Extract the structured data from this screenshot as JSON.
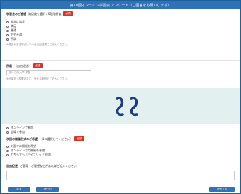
{
  "window": {
    "title": "第10回オンライン学習会 アンケート（ご回答をお願いします）"
  },
  "q1": {
    "label": "学習会のご感想",
    "note": "満足度を選択 / 5段階評価",
    "required_badge": "必須",
    "options": [
      "非常に満足",
      "満足",
      "普通",
      "やや不満",
      "不満"
    ],
    "hint": "※理由がある場合は下の自由記述欄にご記入ください。"
  },
  "q2": {
    "label": "所属",
    "note": "（自由記述）",
    "required_badge": "必須",
    "input_placeholder": "例：〇〇大学 学部",
    "hint": "※団体名・部署名など、分かる範囲でご記入ください。"
  },
  "q3": {
    "options": [
      "オンラインで参加",
      "会場で参加"
    ]
  },
  "q4": {
    "label": "次回の開催形式のご希望",
    "note": "（1つ選択してください）",
    "required_badge": "必須",
    "options": [
      "対面での開催を希望",
      "オンラインでの開催を希望",
      "どちらでも（ハイブリッド形式）"
    ]
  },
  "q5": {
    "label": "自由記述",
    "note": "ご意見・ご要望などがあればご記入ください",
    "input_placeholder": ""
  },
  "buttons": {
    "back": "戻る",
    "reset": "リセット",
    "submit": "送信する"
  },
  "cut_symbol": "≈",
  "colors": {
    "accent": "#2f73b6",
    "required": "#d9342b",
    "cut_band": "#e2f0ef",
    "cut_mark": "#1e3a8a"
  }
}
